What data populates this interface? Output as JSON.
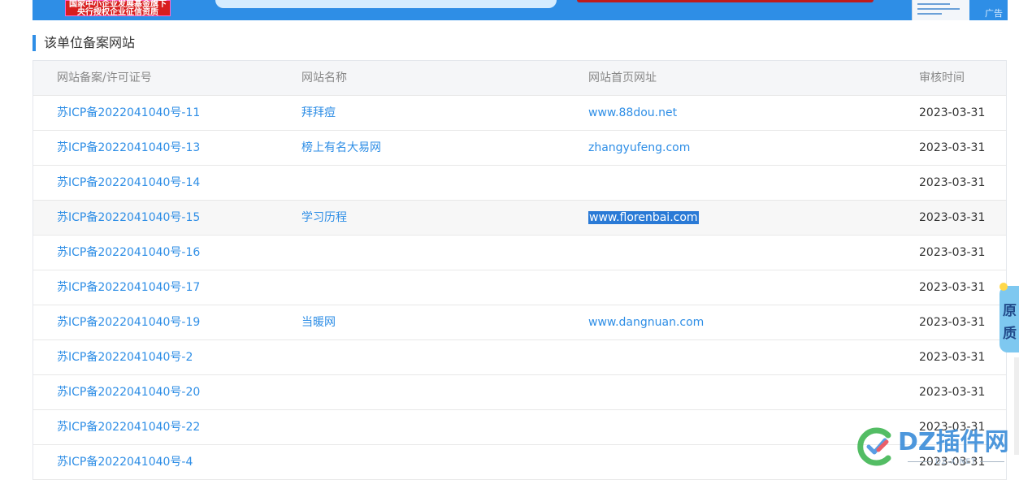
{
  "ad": {
    "badge_line1": "国家中小企业发展基金旗下",
    "badge_line2": "央行授权企业征信资质",
    "tag": "广告"
  },
  "section": {
    "title": "该单位备案网站"
  },
  "table": {
    "headers": [
      "网站备案/许可证号",
      "网站名称",
      "网站首页网址",
      "审核时间"
    ],
    "rows": [
      {
        "license": "苏ICP备2022041040号-11",
        "name": "拜拜痘",
        "url": "www.88dou.net",
        "date": "2023-03-31"
      },
      {
        "license": "苏ICP备2022041040号-13",
        "name": "榜上有名大易网",
        "url": "zhangyufeng.com",
        "date": "2023-03-31"
      },
      {
        "license": "苏ICP备2022041040号-14",
        "name": "",
        "url": "",
        "date": "2023-03-31"
      },
      {
        "license": "苏ICP备2022041040号-15",
        "name": "学习历程",
        "url": "www.florenbai.com",
        "date": "2023-03-31"
      },
      {
        "license": "苏ICP备2022041040号-16",
        "name": "",
        "url": "",
        "date": "2023-03-31"
      },
      {
        "license": "苏ICP备2022041040号-17",
        "name": "",
        "url": "",
        "date": "2023-03-31"
      },
      {
        "license": "苏ICP备2022041040号-19",
        "name": "当暖网",
        "url": "www.dangnuan.com",
        "date": "2023-03-31"
      },
      {
        "license": "苏ICP备2022041040号-2",
        "name": "",
        "url": "",
        "date": "2023-03-31"
      },
      {
        "license": "苏ICP备2022041040号-20",
        "name": "",
        "url": "",
        "date": "2023-03-31"
      },
      {
        "license": "苏ICP备2022041040号-22",
        "name": "",
        "url": "",
        "date": "2023-03-31"
      },
      {
        "license": "苏ICP备2022041040号-4",
        "name": "",
        "url": "",
        "date": "2023-03-31"
      }
    ]
  },
  "float_widget": {
    "line1": "原",
    "line2": "质"
  },
  "watermark": {
    "text": "DZ插件网",
    "sub": "DZ-X.NET"
  },
  "colors": {
    "accent": "#2e8ee6",
    "selection": "#2a7ad6",
    "header_bg": "#f5f6f8"
  }
}
